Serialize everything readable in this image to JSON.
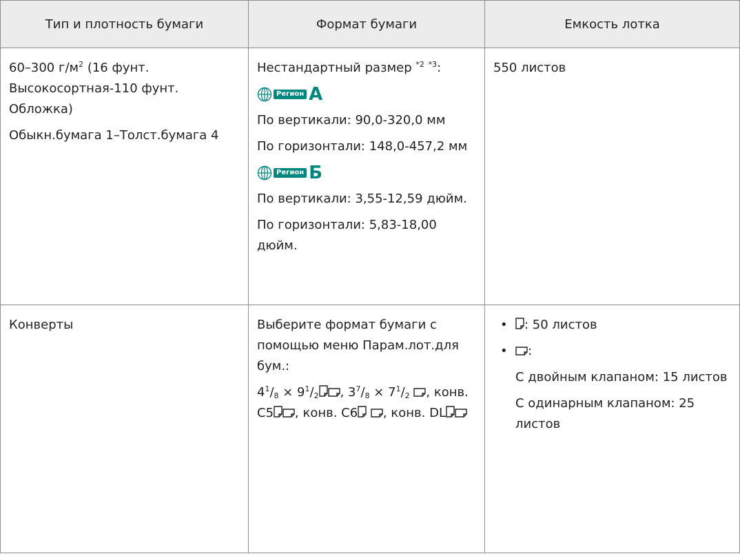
{
  "colors": {
    "header_bg": "#ececec",
    "border": "#8c8c8c",
    "region_teal": "#00877f"
  },
  "header": {
    "col1": "Тип и плотность бумаги",
    "col2": "Формат бумаги",
    "col3": "Емкость лотка"
  },
  "row1": {
    "type_weight": {
      "line1": "60–300 г/м",
      "line1_sup": "2",
      "line1_rest": " (16 фунт. Высокосортная-110 фунт. Обложка)",
      "line2": "Обыкн.бумага 1–Толст.бумага 4"
    },
    "size": {
      "custom_label": "Нестандартный размер ",
      "note1": "*2",
      "note2": "*3",
      "colon": ":",
      "region_pill": "Регион",
      "region_a_letter": "A",
      "region_a_icon": "globe-icon",
      "a_vertical": "По вертикали: 90,0-320,0 мм",
      "a_horizontal": "По горизонтали: 148,0-457,2 мм",
      "region_b_letter": "Б",
      "b_vertical": "По вертикали: 3,55-12,59 дюйм.",
      "b_horizontal": "По горизонтали: 5,83-18,00 дюйм."
    },
    "capacity": "550 листов"
  },
  "row2": {
    "type_weight": "Конверты",
    "size": {
      "intro": "Выберите формат бумаги с помощью меню Парам.лот.для бум.:",
      "s1_a": "4",
      "s1_b": "1",
      "s1_c": "8",
      "s1_d": " × 9",
      "s1_e": "1",
      "s1_f": "2",
      "sep1": ", ",
      "s2_a": "3",
      "s2_b": "7",
      "s2_c": "8",
      "s2_d": " × 7",
      "s2_e": "1",
      "s2_f": "2",
      "c5": ", конв. C5",
      "c6": ", конв. C6",
      "dl": ", конв. DL",
      "portrait_icon": "portrait-feed-icon",
      "landscape_icon": "landscape-feed-icon"
    },
    "capacity": {
      "bullet": "•",
      "item1_text": ": 50 листов",
      "item2_text": ":",
      "double_flap": "С двойным клапаном: 15 листов",
      "single_flap": "С одинарным клапаном: 25 листов"
    }
  }
}
